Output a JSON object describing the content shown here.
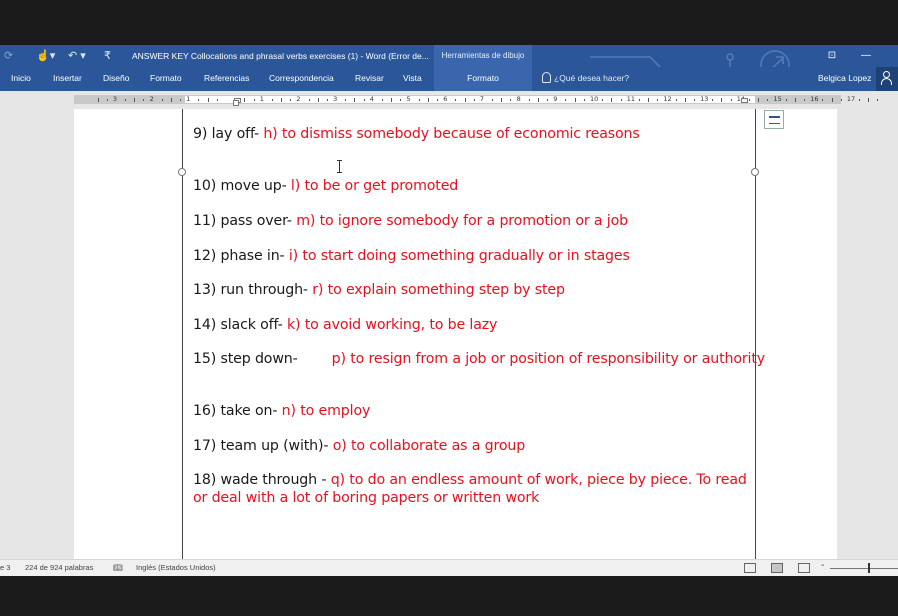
{
  "titlebar": {
    "document_title": "ANSWER KEY Collocations and phrasal verbs exercises (1) - Word (Error de...",
    "context_header": "Herramientas de dibujo",
    "icons": [
      "refresh-icon",
      "touch-mode-icon",
      "undo-icon",
      "customize-qat-icon",
      "ribbon-display-icon",
      "minimize-icon"
    ]
  },
  "ribbon": {
    "tabs": [
      "Inicio",
      "Insertar",
      "Diseño",
      "Formato",
      "Referencias",
      "Correspondencia",
      "Revisar",
      "Vista"
    ],
    "context_tab": "Formato",
    "tell_me": "¿Qué desea hacer?",
    "user": "Belgica Lopez"
  },
  "ruler": {
    "numbers": [
      "3",
      "2",
      "1",
      "1",
      "2",
      "3",
      "4",
      "5",
      "6",
      "7",
      "8",
      "9",
      "10",
      "11",
      "12",
      "13",
      "14",
      "15",
      "16",
      "17"
    ]
  },
  "document": {
    "items": [
      {
        "term": "9)  lay off-  ",
        "answer": "h) to dismiss somebody because of economic reasons"
      },
      {
        "term": "10) move up-  ",
        "answer": "l) to be or get promoted"
      },
      {
        "term": "11) pass over-  ",
        "answer": "m) to ignore somebody for a promotion or a job"
      },
      {
        "term": "12) phase in- ",
        "answer": "i) to start doing something gradually or in stages"
      },
      {
        "term": "13) run through- ",
        "answer": "r) to explain something step by step"
      },
      {
        "term": "14) slack off- ",
        "answer": "k) to avoid working, to be lazy"
      },
      {
        "term": "15) step down-",
        "answer": "p) to resign from a job or position of responsibility or authority"
      },
      {
        "term": "16) take on- ",
        "answer": "n) to employ"
      },
      {
        "term": "17) team up (with)- ",
        "answer": "o) to collaborate as a group"
      },
      {
        "term": "18) wade through - ",
        "answer": "q) to do an endless amount of work, piece by piece. To read or deal with a lot of boring papers or written work"
      }
    ]
  },
  "statusbar": {
    "page": "e 3",
    "words": "224 de 924 palabras",
    "language": "Inglés (Estados Unidos)"
  },
  "colors": {
    "word_blue": "#2b579a",
    "answer_red": "#e8101e",
    "context_blue": "#3a66ad"
  }
}
